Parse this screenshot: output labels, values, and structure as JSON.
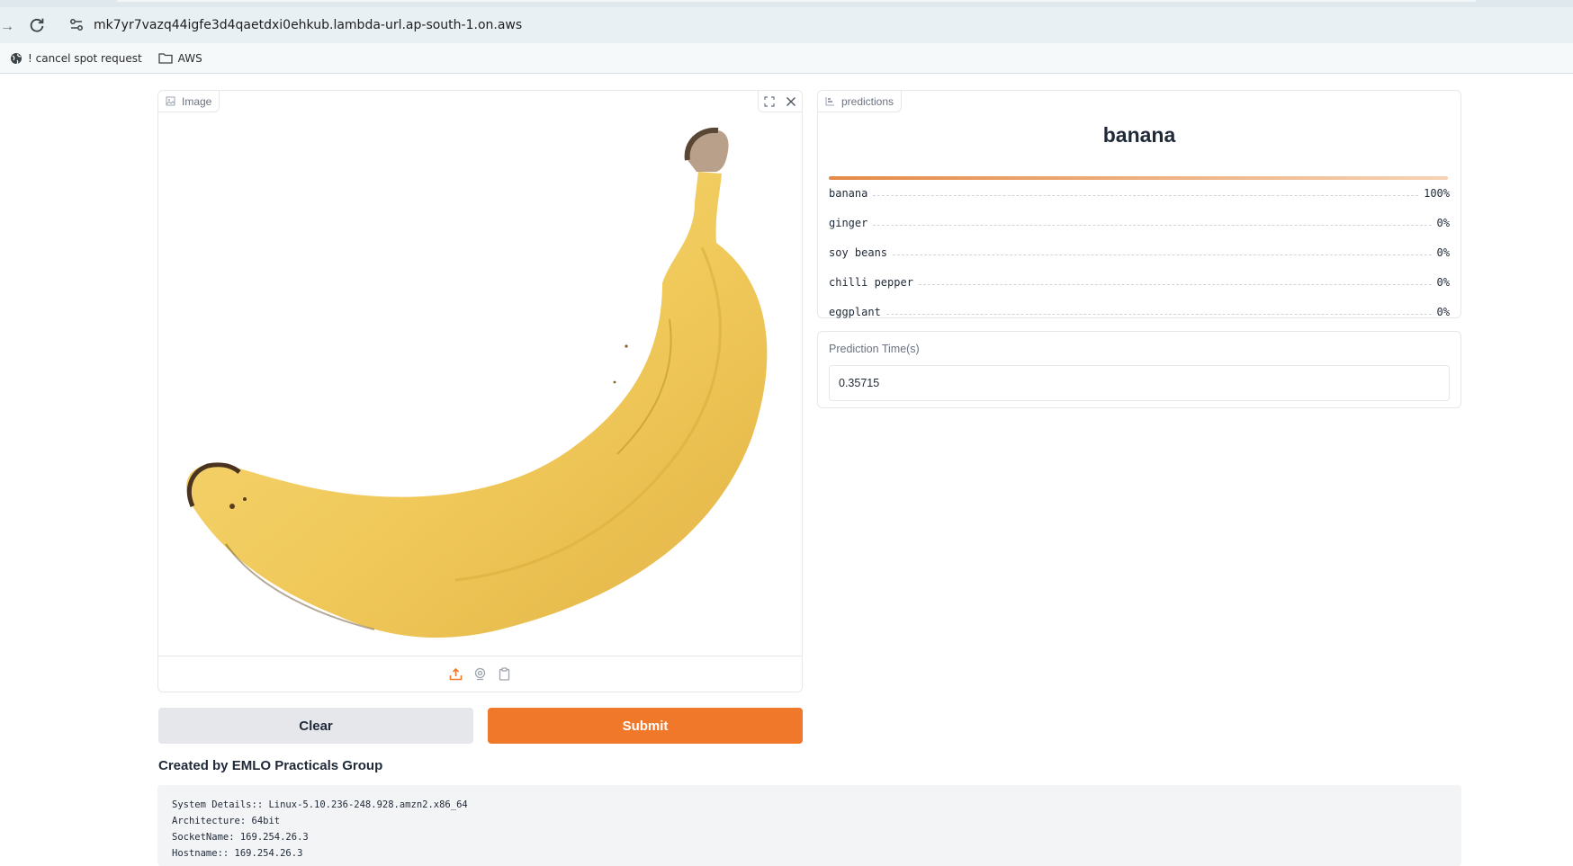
{
  "browser": {
    "url": "mk7yr7vazq44igfe3d4qaetdxi0ehkub.lambda-url.ap-south-1.on.aws",
    "bookmarks": [
      {
        "label": "! cancel spot request",
        "icon": "globe-icon"
      },
      {
        "label": "AWS",
        "icon": "folder-icon"
      }
    ]
  },
  "image_panel": {
    "label": "Image",
    "tools": [
      "fullscreen-icon",
      "close-icon"
    ],
    "footer_icons": [
      "upload-icon",
      "webcam-icon",
      "clipboard-icon"
    ]
  },
  "buttons": {
    "clear": "Clear",
    "submit": "Submit"
  },
  "credits": "Created by EMLO Practicals Group",
  "system": {
    "lines": [
      "System Details:: Linux-5.10.236-248.928.amzn2.x86_64",
      "Architecture: 64bit",
      "SocketName: 169.254.26.3",
      "Hostname:: 169.254.26.3"
    ]
  },
  "predictions": {
    "label": "predictions",
    "top_label": "banana",
    "top_confidence": 1.0,
    "items": [
      {
        "label": "banana",
        "pct": "100%"
      },
      {
        "label": "ginger",
        "pct": "0%"
      },
      {
        "label": "soy beans",
        "pct": "0%"
      },
      {
        "label": "chilli pepper",
        "pct": "0%"
      },
      {
        "label": "eggplant",
        "pct": "0%"
      }
    ]
  },
  "prediction_time": {
    "label": "Prediction Time(s)",
    "value": "0.35715"
  },
  "colors": {
    "accent": "#f0782a",
    "button_secondary": "#e5e7eb",
    "banana_yellow": "#f2cf63"
  }
}
